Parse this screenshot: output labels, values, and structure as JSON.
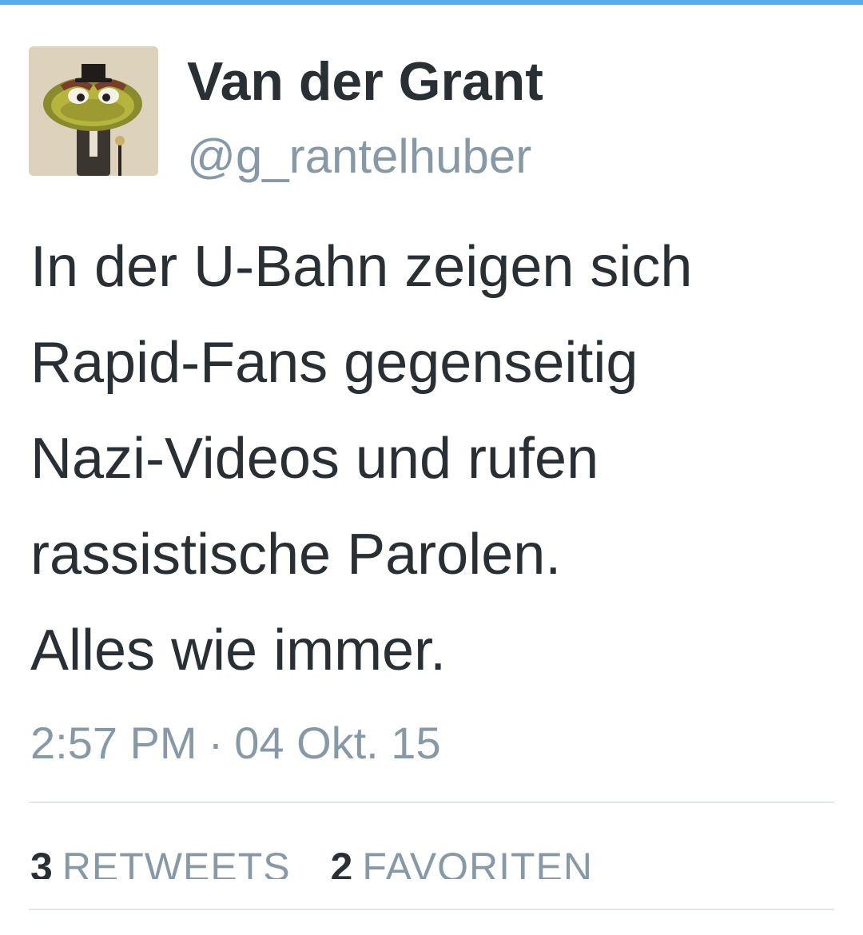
{
  "accent_color": "#55acee",
  "user": {
    "display_name": "Van der Grant",
    "handle": "@g_rantelhuber",
    "avatar_icon": "avatar-image"
  },
  "tweet": {
    "lines": [
      "In der U-Bahn zeigen sich",
      "Rapid-Fans gegenseitig",
      "Nazi-Videos und rufen",
      "rassistische Parolen.",
      "Alles wie immer."
    ],
    "time": "2:57 PM",
    "separator": "·",
    "date": "04 Okt. 15"
  },
  "stats": {
    "retweets_count": "3",
    "retweets_label": "RETWEETS",
    "favorites_count": "2",
    "favorites_label": "FAVORITEN"
  }
}
